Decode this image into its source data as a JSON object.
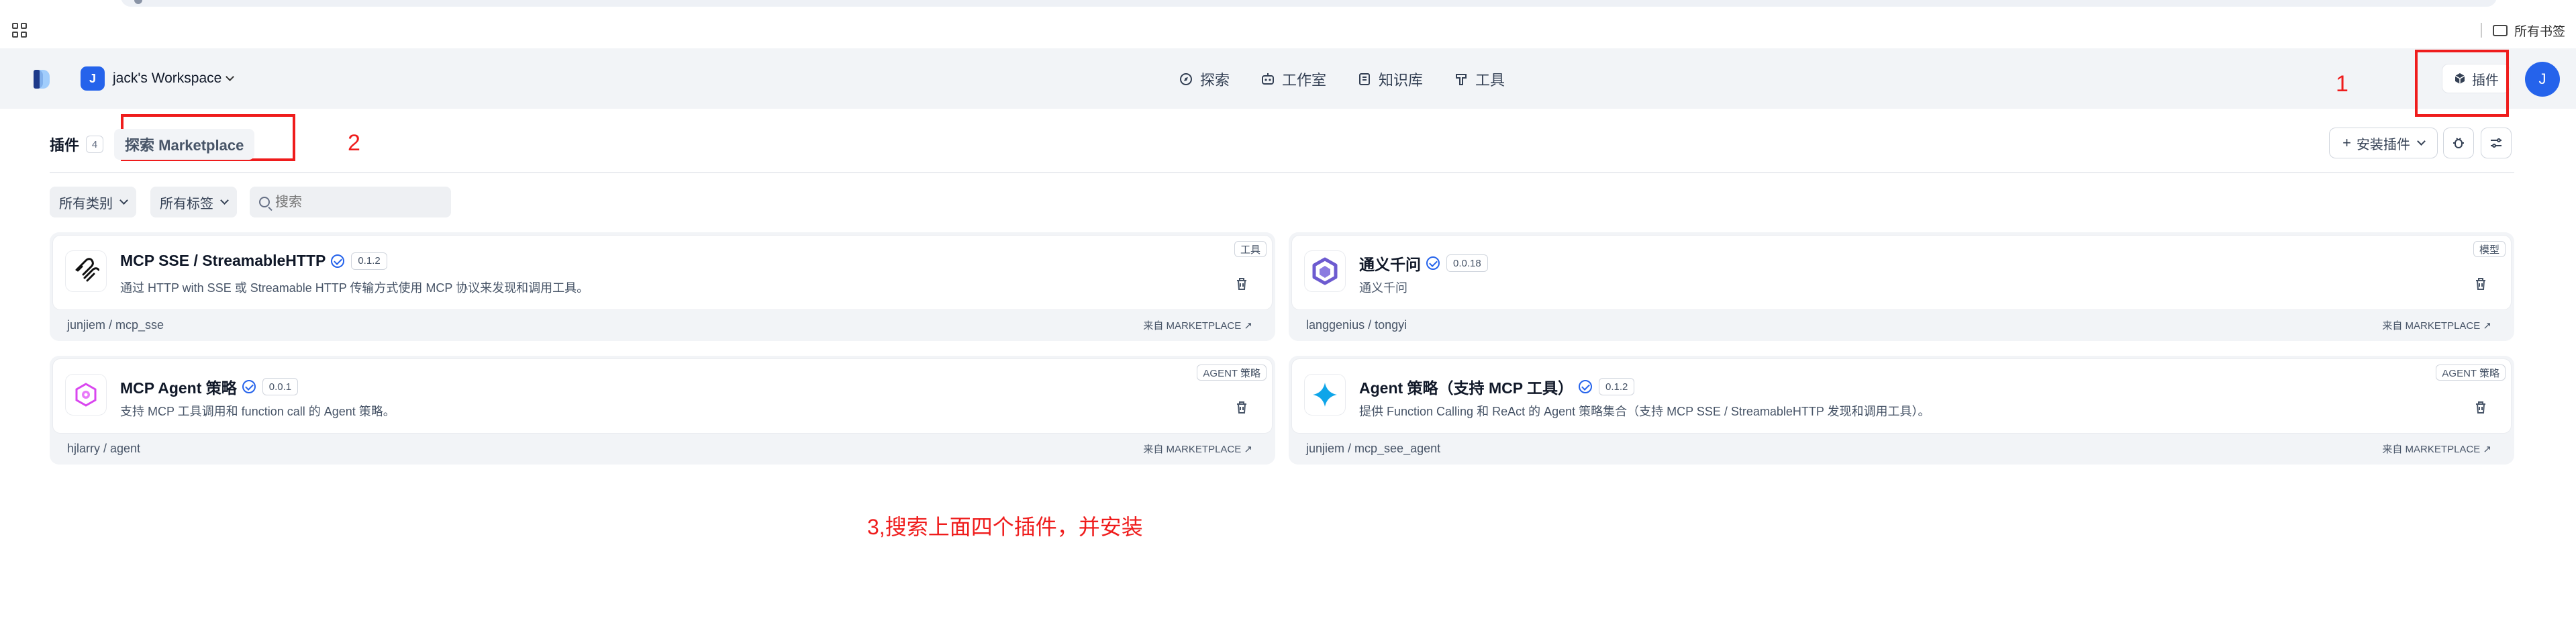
{
  "browser": {
    "bookmarks_label": "所有书签"
  },
  "header": {
    "workspace_initial": "J",
    "workspace_name": "jack's Workspace",
    "nav": [
      {
        "label": "探索",
        "icon": "compass-icon"
      },
      {
        "label": "工作室",
        "icon": "robot-icon"
      },
      {
        "label": "知识库",
        "icon": "book-icon"
      },
      {
        "label": "工具",
        "icon": "hammer-icon"
      }
    ],
    "plugins_label": "插件",
    "user_initial": "J"
  },
  "tabs": {
    "plugins_label": "插件",
    "plugins_count": "4",
    "marketplace_label": "探索 Marketplace"
  },
  "toolbar": {
    "install_label": "安装插件"
  },
  "filters": {
    "category_label": "所有类别",
    "tag_label": "所有标签",
    "search_placeholder": "搜索"
  },
  "plugins": [
    {
      "name": "MCP SSE / StreamableHTTP",
      "version": "0.1.2",
      "description": "通过 HTTP with SSE 或 Streamable HTTP 传输方式使用 MCP 协议来发现和调用工具。",
      "category": "工具",
      "author": "junjiem / mcp_sse",
      "source": "来自 MARKETPLACE ↗",
      "icon": "mcp-logo-icon"
    },
    {
      "name": "通义千问",
      "version": "0.0.18",
      "description": "通义千问",
      "category": "模型",
      "author": "langgenius / tongyi",
      "source": "来自 MARKETPLACE ↗",
      "icon": "tongyi-logo-icon"
    },
    {
      "name": "MCP Agent 策略",
      "version": "0.0.1",
      "description": "支持 MCP 工具调用和 function call 的 Agent 策略。",
      "category": "AGENT 策略",
      "author": "hjlarry / agent",
      "source": "来自 MARKETPLACE ↗",
      "icon": "agent-strategy-icon"
    },
    {
      "name": "Agent 策略（支持 MCP 工具）",
      "version": "0.1.2",
      "description": "提供 Function Calling 和 ReAct 的 Agent 策略集合（支持 MCP SSE / StreamableHTTP 发现和调用工具）。",
      "category": "AGENT 策略",
      "author": "junjiem / mcp_see_agent",
      "source": "来自 MARKETPLACE ↗",
      "icon": "sparkle-icon"
    }
  ],
  "annotations": {
    "mark1": "1",
    "mark2": "2",
    "instruction": "3,搜索上面四个插件，并安装"
  },
  "colors": {
    "accent": "#2563eb",
    "annotation": "#ef1c1c",
    "header_bg": "#f2f4f7"
  }
}
